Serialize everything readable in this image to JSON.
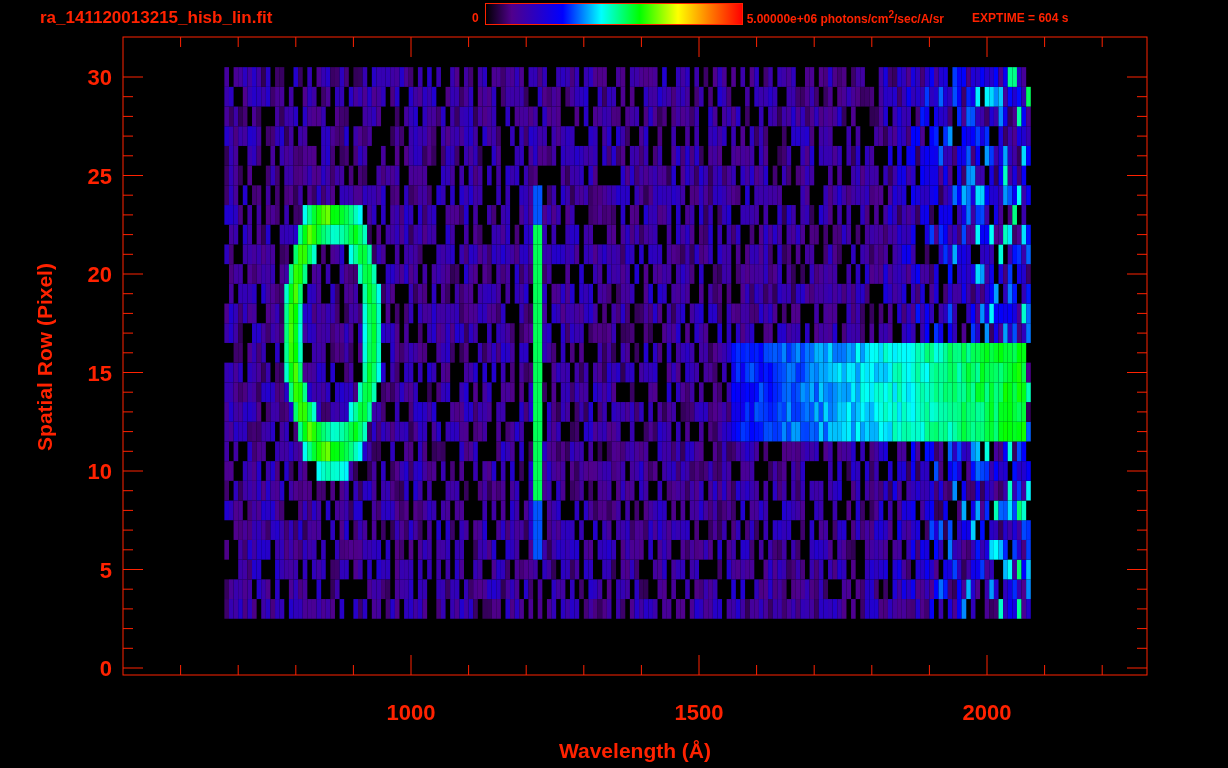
{
  "title": "ra_141120013215_hisb_lin.fit",
  "colorbar": {
    "min_label": "0",
    "max_label": "5.00000e+06 photons/cm$^{2}$/sec/A/sr"
  },
  "exposure": "EXPTIME = 604 s",
  "y_axis": {
    "label": "Spatial Row (Pixel)",
    "ticks": [
      "30",
      "25",
      "20",
      "15",
      "10",
      "5",
      "0"
    ]
  },
  "x_axis": {
    "label": "Wavelength (Å)",
    "ticks": [
      "1000",
      "1500",
      "2000"
    ]
  }
}
